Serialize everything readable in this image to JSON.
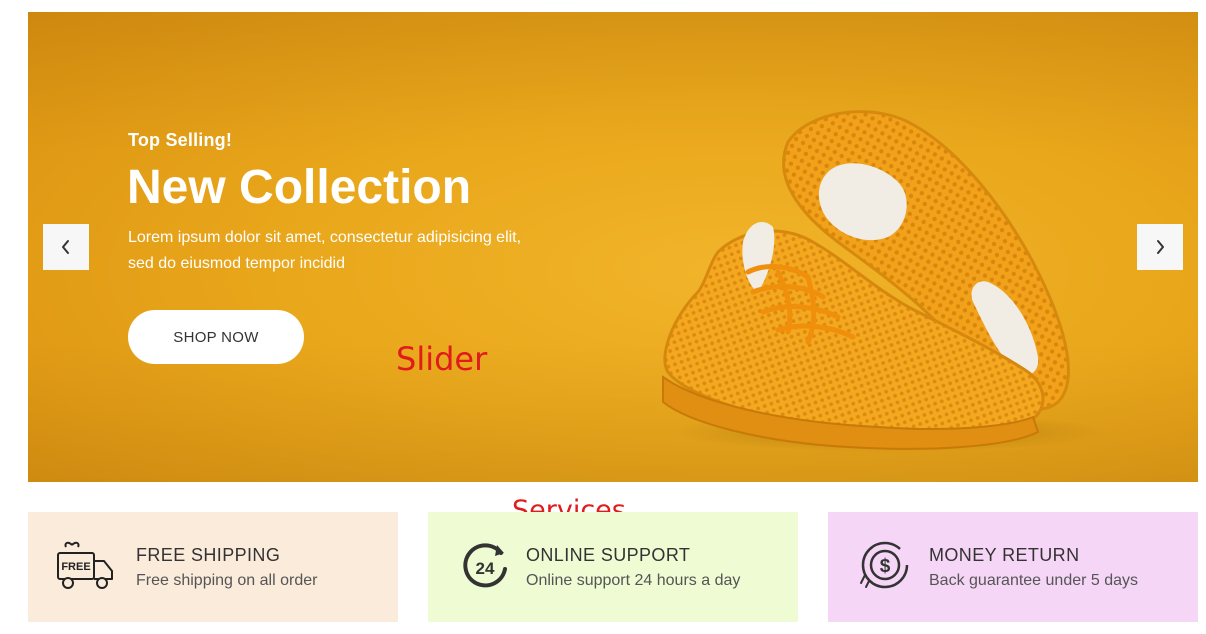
{
  "slider": {
    "eyebrow": "Top Selling!",
    "headline": "New Collection",
    "description": "Lorem ipsum dolor sit amet, consectetur adipisicing elit, sed do eiusmod tempor incidid",
    "cta_label": "SHOP NOW",
    "prev_icon": "chevron-left-icon",
    "next_icon": "chevron-right-icon",
    "background_color": "#e9a71b"
  },
  "annotations": {
    "slider": "Slider",
    "services": "Services",
    "color": "#e11b1b"
  },
  "services": [
    {
      "icon": "free-delivery-truck-icon",
      "icon_text": "FREE",
      "title": "FREE SHIPPING",
      "subtitle": "Free shipping on all order",
      "background": "#fbebdb"
    },
    {
      "icon": "support-24-hours-icon",
      "icon_text": "24",
      "title": "ONLINE SUPPORT",
      "subtitle": "Online support 24 hours a day",
      "background": "#eefbd3"
    },
    {
      "icon": "money-return-icon",
      "icon_text": "$",
      "title": "MONEY RETURN",
      "subtitle": "Back guarantee under 5 days",
      "background": "#f6d6f6"
    }
  ]
}
